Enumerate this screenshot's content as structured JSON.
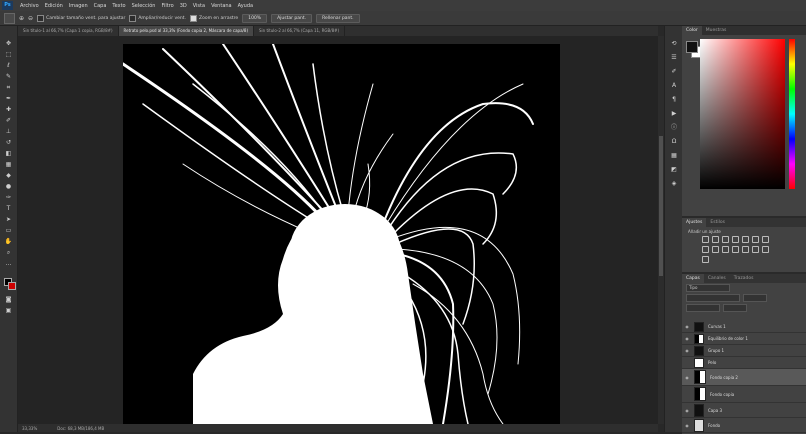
{
  "menu": {
    "logo": "Ps",
    "items": [
      "Archivo",
      "Edición",
      "Imagen",
      "Capa",
      "Texto",
      "Selección",
      "Filtro",
      "3D",
      "Vista",
      "Ventana",
      "Ayuda"
    ]
  },
  "options_bar": {
    "option1": "Cambiar tamaño vent. para ajustar",
    "option2": "Ampliar/reducir vent.",
    "option3": "Zoom en arrastre",
    "zoom_button": "100%",
    "fit_button": "Ajustar pant.",
    "fill_button": "Rellenar pant."
  },
  "tabs": [
    {
      "label": "Sin título-1 al 66,7% (Capa 1 copia, RGB/8#)",
      "active": false
    },
    {
      "label": "Retrato pelo.psd al 33,3% (Fondo copia 2, Máscara de capa/8)",
      "active": true
    },
    {
      "label": "Sin título-2 al 66,7% (Capa 11, RGB/8#)",
      "active": false
    }
  ],
  "status": {
    "zoom": "33,33%",
    "doc": "Doc: 68,3 MB/186,4 MB"
  },
  "right_panels": {
    "color_tabs": [
      "Color",
      "Muestras"
    ],
    "adjust_tabs": [
      "Ajustes",
      "Estilos"
    ],
    "adjust_title": "Añadir un ajuste",
    "layer_tabs": [
      "Capas",
      "Canales",
      "Trazados"
    ],
    "layer_filter": "Tipo",
    "layers": [
      {
        "name": "Curvas 1",
        "thumb": "dark"
      },
      {
        "name": "Equilibrio de color 1",
        "thumb": "mask"
      },
      {
        "name": "Grupo 1",
        "thumb": "dark"
      },
      {
        "name": "Pelo",
        "thumb": "light"
      },
      {
        "name": "Fondo copia 2",
        "thumb": "mask",
        "selected": true
      },
      {
        "name": "Fondo copia",
        "thumb": "mask"
      },
      {
        "name": "Capa 3",
        "thumb": "dark"
      },
      {
        "name": "Fondo",
        "thumb": "light"
      }
    ]
  }
}
